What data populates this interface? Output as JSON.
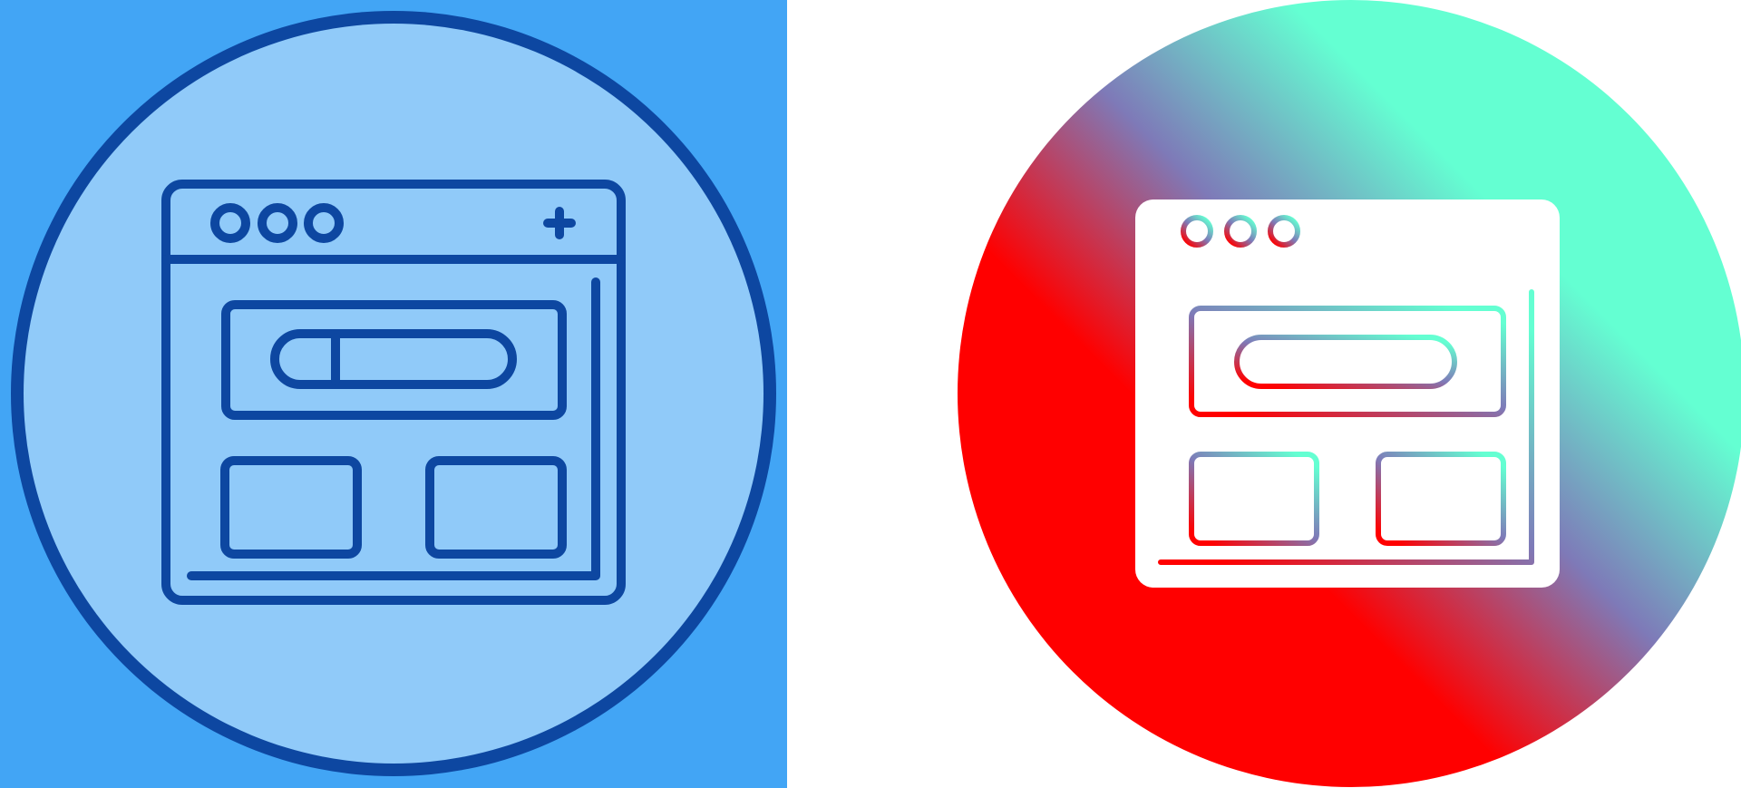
{
  "icons": [
    {
      "name": "browser-window-icon",
      "style": "line",
      "colors": {
        "square_background": "#42A5F5",
        "circle_fill": "#90CAF9",
        "stroke": "#0D47A1"
      }
    },
    {
      "name": "browser-window-icon",
      "style": "gradient",
      "colors": {
        "page_background": "#FFFFFF",
        "gradient_start": "#FF0000",
        "gradient_mid": "#7E7AB8",
        "gradient_end": "#64FFD2",
        "window_fill": "#FFFFFF"
      }
    }
  ]
}
